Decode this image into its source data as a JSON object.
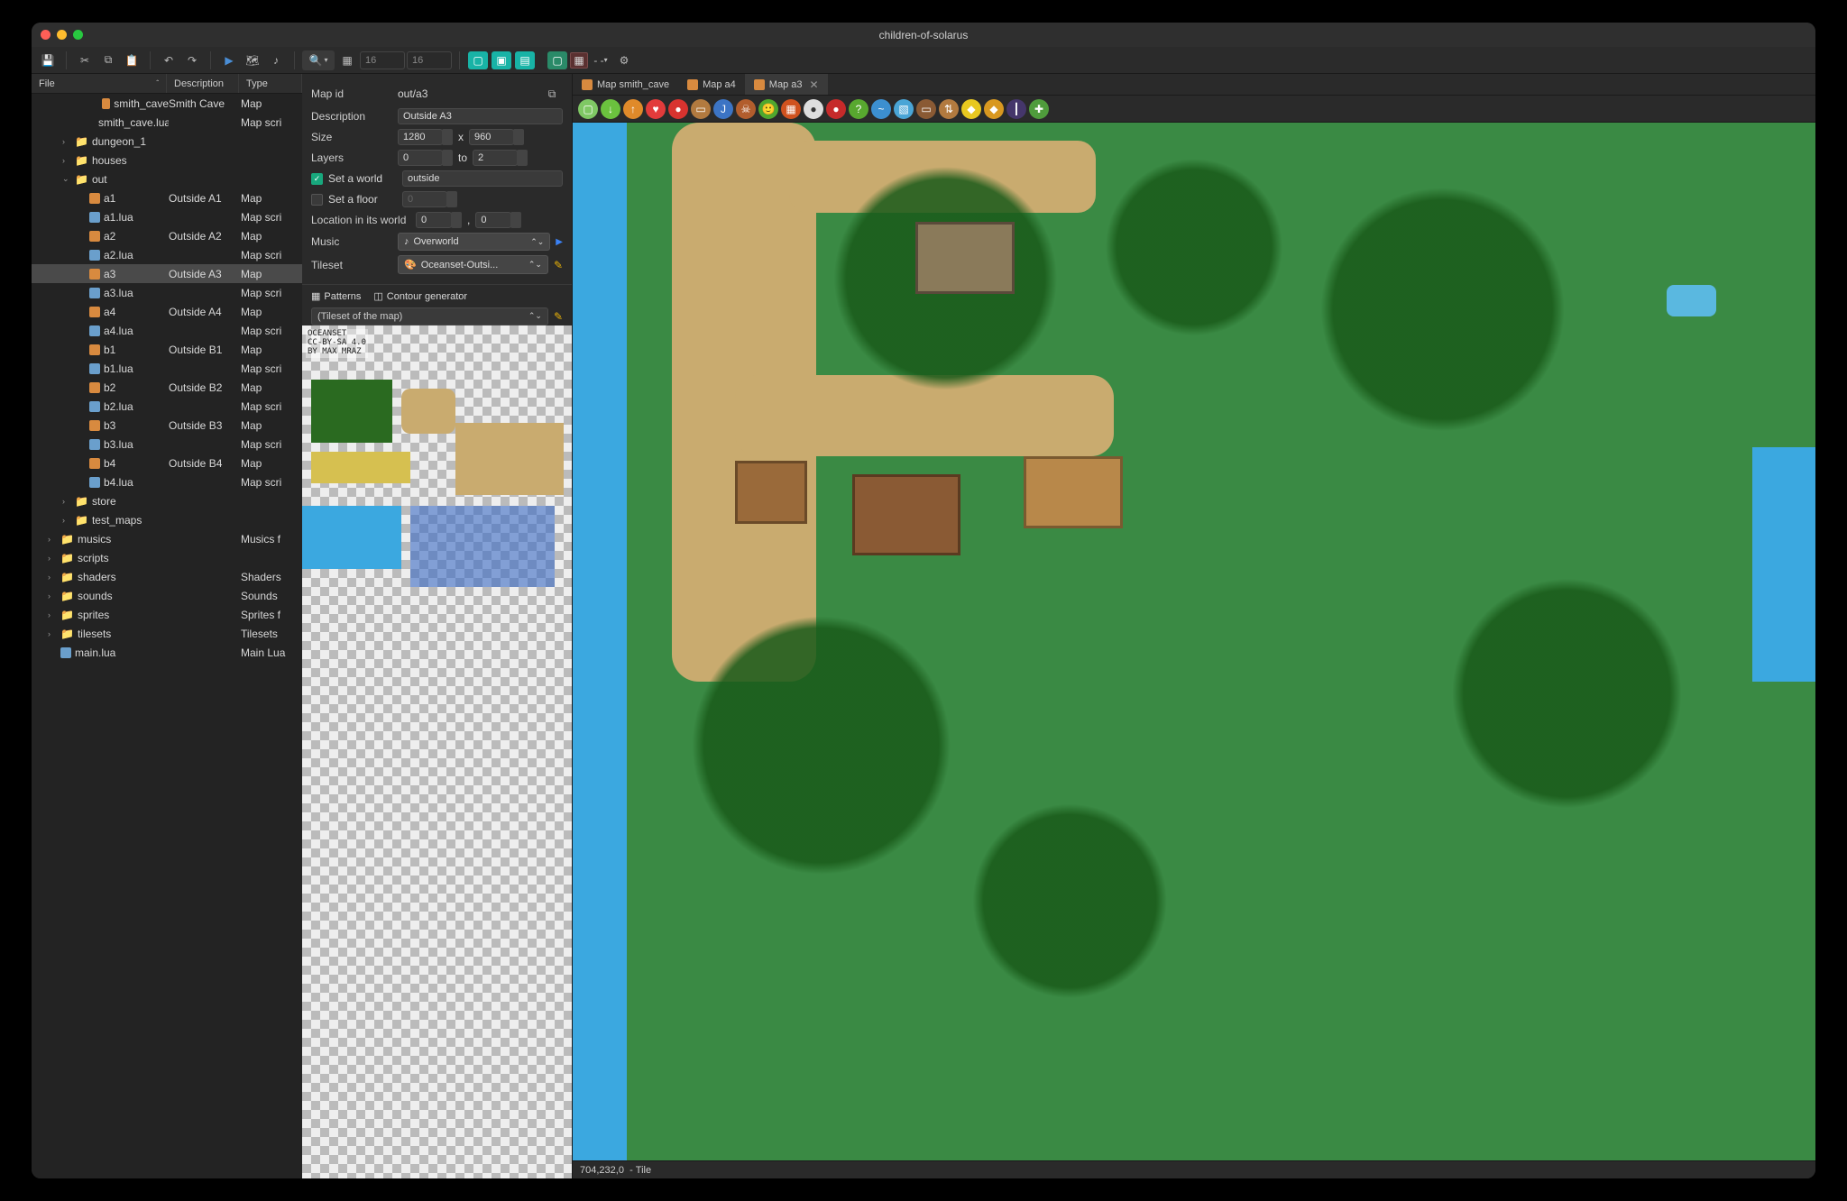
{
  "window": {
    "title": "children-of-solarus"
  },
  "toolbar": {
    "grid_w": "16",
    "grid_h": "16",
    "zoom_placeholder": "- -"
  },
  "tree": {
    "cols": {
      "file": "File",
      "desc": "Description",
      "type": "Type"
    },
    "rows": [
      {
        "indent": 3,
        "icon": "map",
        "name": "smith_cave",
        "desc": "Smith Cave",
        "type": "Map"
      },
      {
        "indent": 3,
        "icon": "lua",
        "name": "smith_cave.lua",
        "desc": "",
        "type": "Map scri"
      },
      {
        "indent": 1,
        "icon": "folder",
        "chev": ">",
        "name": "dungeon_1",
        "desc": "",
        "type": ""
      },
      {
        "indent": 1,
        "icon": "folder",
        "chev": ">",
        "name": "houses",
        "desc": "",
        "type": ""
      },
      {
        "indent": 1,
        "icon": "folder",
        "chev": "v",
        "name": "out",
        "desc": "",
        "type": ""
      },
      {
        "indent": 2,
        "icon": "map",
        "name": "a1",
        "desc": "Outside A1",
        "type": "Map"
      },
      {
        "indent": 2,
        "icon": "lua",
        "name": "a1.lua",
        "desc": "",
        "type": "Map scri"
      },
      {
        "indent": 2,
        "icon": "map",
        "name": "a2",
        "desc": "Outside A2",
        "type": "Map"
      },
      {
        "indent": 2,
        "icon": "lua",
        "name": "a2.lua",
        "desc": "",
        "type": "Map scri"
      },
      {
        "indent": 2,
        "icon": "map",
        "name": "a3",
        "desc": "Outside A3",
        "type": "Map",
        "selected": true
      },
      {
        "indent": 2,
        "icon": "lua",
        "name": "a3.lua",
        "desc": "",
        "type": "Map scri"
      },
      {
        "indent": 2,
        "icon": "map",
        "name": "a4",
        "desc": "Outside A4",
        "type": "Map"
      },
      {
        "indent": 2,
        "icon": "lua",
        "name": "a4.lua",
        "desc": "",
        "type": "Map scri"
      },
      {
        "indent": 2,
        "icon": "map",
        "name": "b1",
        "desc": "Outside B1",
        "type": "Map"
      },
      {
        "indent": 2,
        "icon": "lua",
        "name": "b1.lua",
        "desc": "",
        "type": "Map scri"
      },
      {
        "indent": 2,
        "icon": "map",
        "name": "b2",
        "desc": "Outside B2",
        "type": "Map"
      },
      {
        "indent": 2,
        "icon": "lua",
        "name": "b2.lua",
        "desc": "",
        "type": "Map scri"
      },
      {
        "indent": 2,
        "icon": "map",
        "name": "b3",
        "desc": "Outside B3",
        "type": "Map"
      },
      {
        "indent": 2,
        "icon": "lua",
        "name": "b3.lua",
        "desc": "",
        "type": "Map scri"
      },
      {
        "indent": 2,
        "icon": "map",
        "name": "b4",
        "desc": "Outside B4",
        "type": "Map"
      },
      {
        "indent": 2,
        "icon": "lua",
        "name": "b4.lua",
        "desc": "",
        "type": "Map scri"
      },
      {
        "indent": 1,
        "icon": "folder",
        "chev": ">",
        "name": "store",
        "desc": "",
        "type": ""
      },
      {
        "indent": 1,
        "icon": "folder",
        "chev": ">",
        "name": "test_maps",
        "desc": "",
        "type": ""
      },
      {
        "indent": 0,
        "icon": "folder-b",
        "chev": ">",
        "name": "musics",
        "desc": "",
        "type": "Musics f"
      },
      {
        "indent": 0,
        "icon": "folder-b",
        "chev": ">",
        "name": "scripts",
        "desc": "",
        "type": ""
      },
      {
        "indent": 0,
        "icon": "folder-b",
        "chev": ">",
        "name": "shaders",
        "desc": "",
        "type": "Shaders"
      },
      {
        "indent": 0,
        "icon": "folder-b",
        "chev": ">",
        "name": "sounds",
        "desc": "",
        "type": "Sounds"
      },
      {
        "indent": 0,
        "icon": "folder-b",
        "chev": ">",
        "name": "sprites",
        "desc": "",
        "type": "Sprites f"
      },
      {
        "indent": 0,
        "icon": "folder-b",
        "chev": ">",
        "name": "tilesets",
        "desc": "",
        "type": "Tilesets"
      },
      {
        "indent": 0,
        "icon": "lua",
        "name": "main.lua",
        "desc": "",
        "type": "Main Lua"
      }
    ]
  },
  "tabs": [
    {
      "label": "Map smith_cave",
      "icon": "map",
      "active": false
    },
    {
      "label": "Map a4",
      "icon": "map",
      "active": false
    },
    {
      "label": "Map a3",
      "icon": "map",
      "active": true
    }
  ],
  "props": {
    "map_id": {
      "label": "Map id",
      "value": "out/a3"
    },
    "description": {
      "label": "Description",
      "value": "Outside A3"
    },
    "size": {
      "label": "Size",
      "w": "1280",
      "x": "x",
      "h": "960"
    },
    "layers": {
      "label": "Layers",
      "from": "0",
      "to_label": "to",
      "to": "2"
    },
    "world": {
      "label": "Set a world",
      "checked": true,
      "value": "outside"
    },
    "floor": {
      "label": "Set a floor",
      "checked": false,
      "value": "0"
    },
    "location": {
      "label": "Location in its world",
      "x": "0",
      "sep": ",",
      "y": "0"
    },
    "music": {
      "label": "Music",
      "value": "Overworld"
    },
    "tileset": {
      "label": "Tileset",
      "value": "Oceanset-Outsi..."
    }
  },
  "patterns": {
    "tab_patterns": "Patterns",
    "tab_contour": "Contour generator",
    "combo": "(Tileset of the map)",
    "credit_lines": [
      "OCEANSET",
      "CC-BY-SA 4.0",
      "BY MAX MRAZ"
    ]
  },
  "entity_icons": [
    {
      "name": "destination-icon",
      "bg": "#7fc864",
      "txt": "▢"
    },
    {
      "name": "arrow-down-icon",
      "bg": "#6bc13e",
      "txt": "↓"
    },
    {
      "name": "arrow-up-icon",
      "bg": "#e08a2a",
      "txt": "↑"
    },
    {
      "name": "pickable-icon",
      "bg": "#e23b3b",
      "txt": "♥"
    },
    {
      "name": "destructible-icon",
      "bg": "#d8332f",
      "txt": "●"
    },
    {
      "name": "chest-icon",
      "bg": "#b27a3f",
      "txt": "▭"
    },
    {
      "name": "jumper-icon",
      "bg": "#3c74c4",
      "txt": "J"
    },
    {
      "name": "enemy-icon",
      "bg": "#b25d2d",
      "txt": "☠"
    },
    {
      "name": "npc-icon",
      "bg": "#4fa82e",
      "txt": "🙂"
    },
    {
      "name": "block-icon",
      "bg": "#d0521f",
      "txt": "▦"
    },
    {
      "name": "switch-icon",
      "bg": "#ddd",
      "txt": "●"
    },
    {
      "name": "sensor-icon",
      "bg": "#c62a2a",
      "txt": "●"
    },
    {
      "name": "custom-icon",
      "bg": "#58a82f",
      "txt": "?"
    },
    {
      "name": "dynamic-tile-icon",
      "bg": "#3c8fd0",
      "txt": "~"
    },
    {
      "name": "stream-icon",
      "bg": "#4aa5d6",
      "txt": "▧"
    },
    {
      "name": "door-icon",
      "bg": "#8a5a34",
      "txt": "▭"
    },
    {
      "name": "stairs-icon",
      "bg": "#b27a3f",
      "txt": "⇅"
    },
    {
      "name": "crystal-icon",
      "bg": "#e8c820",
      "txt": "◆"
    },
    {
      "name": "crystal-block-icon",
      "bg": "#d89820",
      "txt": "◆"
    },
    {
      "name": "separator-icon",
      "bg": "#45366b",
      "txt": "┃"
    },
    {
      "name": "wall-icon",
      "bg": "#4f9c3c",
      "txt": "✚"
    }
  ],
  "statusbar": {
    "coords": "704,232,0",
    "sep": "-",
    "entity": "Tile"
  }
}
